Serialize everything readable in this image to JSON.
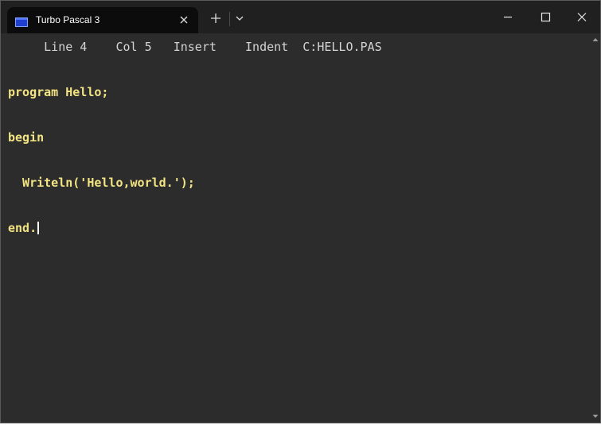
{
  "window": {
    "tab_title": "Turbo Pascal 3"
  },
  "editor": {
    "status": {
      "line": "Line 4",
      "col": "Col 5",
      "mode": "Insert",
      "indent": "Indent",
      "file": "C:HELLO.PAS"
    },
    "code_lines": [
      "program Hello;",
      "begin",
      "  Writeln('Hello,world.');",
      "end."
    ]
  },
  "colors": {
    "code_text": "#f2e383",
    "status_text": "#d4d4d4",
    "background": "#2c2c2c",
    "titlebar": "#202020",
    "tab": "#0c0c0c"
  },
  "icons": [
    "terminal-icon",
    "close-icon",
    "plus-icon",
    "chevron-down-icon",
    "minimize-icon",
    "maximize-icon",
    "scroll-up-icon",
    "scroll-down-icon"
  ]
}
